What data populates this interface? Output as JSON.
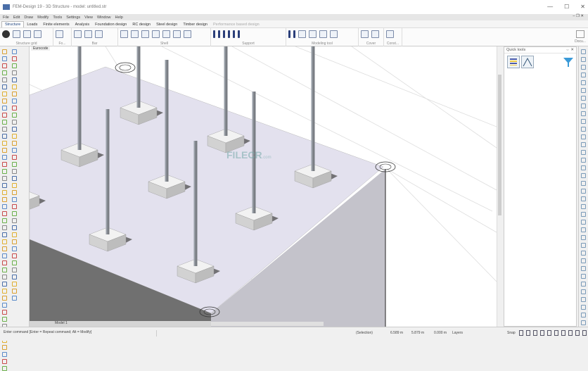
{
  "window": {
    "title": "FEM-Design 19 - 3D Structure - model: untitled.str",
    "minimize": "—",
    "maximize": "☐",
    "close": "✕"
  },
  "menu": [
    "File",
    "Edit",
    "Draw",
    "Modify",
    "Tools",
    "Settings",
    "View",
    "Window",
    "Help"
  ],
  "tabs": [
    {
      "label": "Structure",
      "active": true
    },
    {
      "label": "Loads"
    },
    {
      "label": "Finite elements"
    },
    {
      "label": "Analysis"
    },
    {
      "label": "Foundation design"
    },
    {
      "label": "RC design"
    },
    {
      "label": "Steel design"
    },
    {
      "label": "Timber design"
    },
    {
      "label": "Performance based design",
      "disabled": true
    }
  ],
  "ribbon_groups": [
    {
      "label": "Structure grid"
    },
    {
      "label": "Fo..."
    },
    {
      "label": "Bar"
    },
    {
      "label": "Shell"
    },
    {
      "label": "Support"
    },
    {
      "label": "Modeling tool"
    },
    {
      "label": "Cover"
    },
    {
      "label": "Const..."
    }
  ],
  "doc_label": "Docu...",
  "canvas": {
    "code_label": "Eurocode",
    "model_tab": "Model 1",
    "watermark": "FILECR",
    "watermark_sub": ".com"
  },
  "quick_tools": {
    "title": "Quick tools",
    "pin": "⇔ ✕"
  },
  "status": {
    "command": "Enter command [Enter = Repeat command; Alt = Modify]",
    "selection": "(Selection)",
    "x": "6.589 m",
    "y": "5.879 m",
    "z": "0.000 m",
    "layers": "Layers",
    "snap": "Snap"
  },
  "colors": {
    "accent": "#1a3f7a",
    "plate_top": "#e3e1ee",
    "plate_side": "#c4c3cb",
    "plate_front": "#707070"
  },
  "columns": [
    [
      113,
      225,
      65
    ],
    [
      197,
      165,
      65
    ],
    [
      153,
      345,
      155
    ],
    [
      237,
      270,
      85
    ],
    [
      278,
      390,
      200
    ],
    [
      321,
      205,
      65
    ],
    [
      361,
      315,
      130
    ],
    [
      445,
      255,
      65
    ],
    [
      30,
      290,
      0
    ]
  ]
}
